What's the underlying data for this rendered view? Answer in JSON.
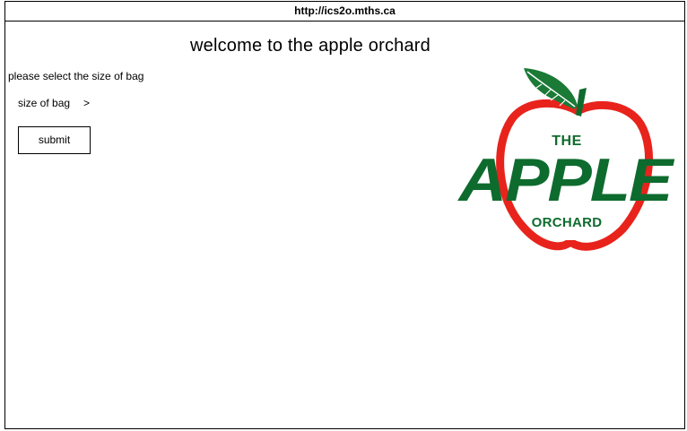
{
  "browser": {
    "url": "http://ics2o.mths.ca"
  },
  "page": {
    "title": "welcome to the apple orchard",
    "prompt": "please select the size of bag",
    "size_label": "size of bag",
    "size_arrow": ">",
    "submit_label": "submit"
  },
  "logo": {
    "line1": "THE",
    "line2": "APPLE",
    "line3": "ORCHARD",
    "colors": {
      "apple_outline": "#e8231c",
      "text_green": "#0e6b2e",
      "leaf_green": "#1a7a36"
    }
  }
}
